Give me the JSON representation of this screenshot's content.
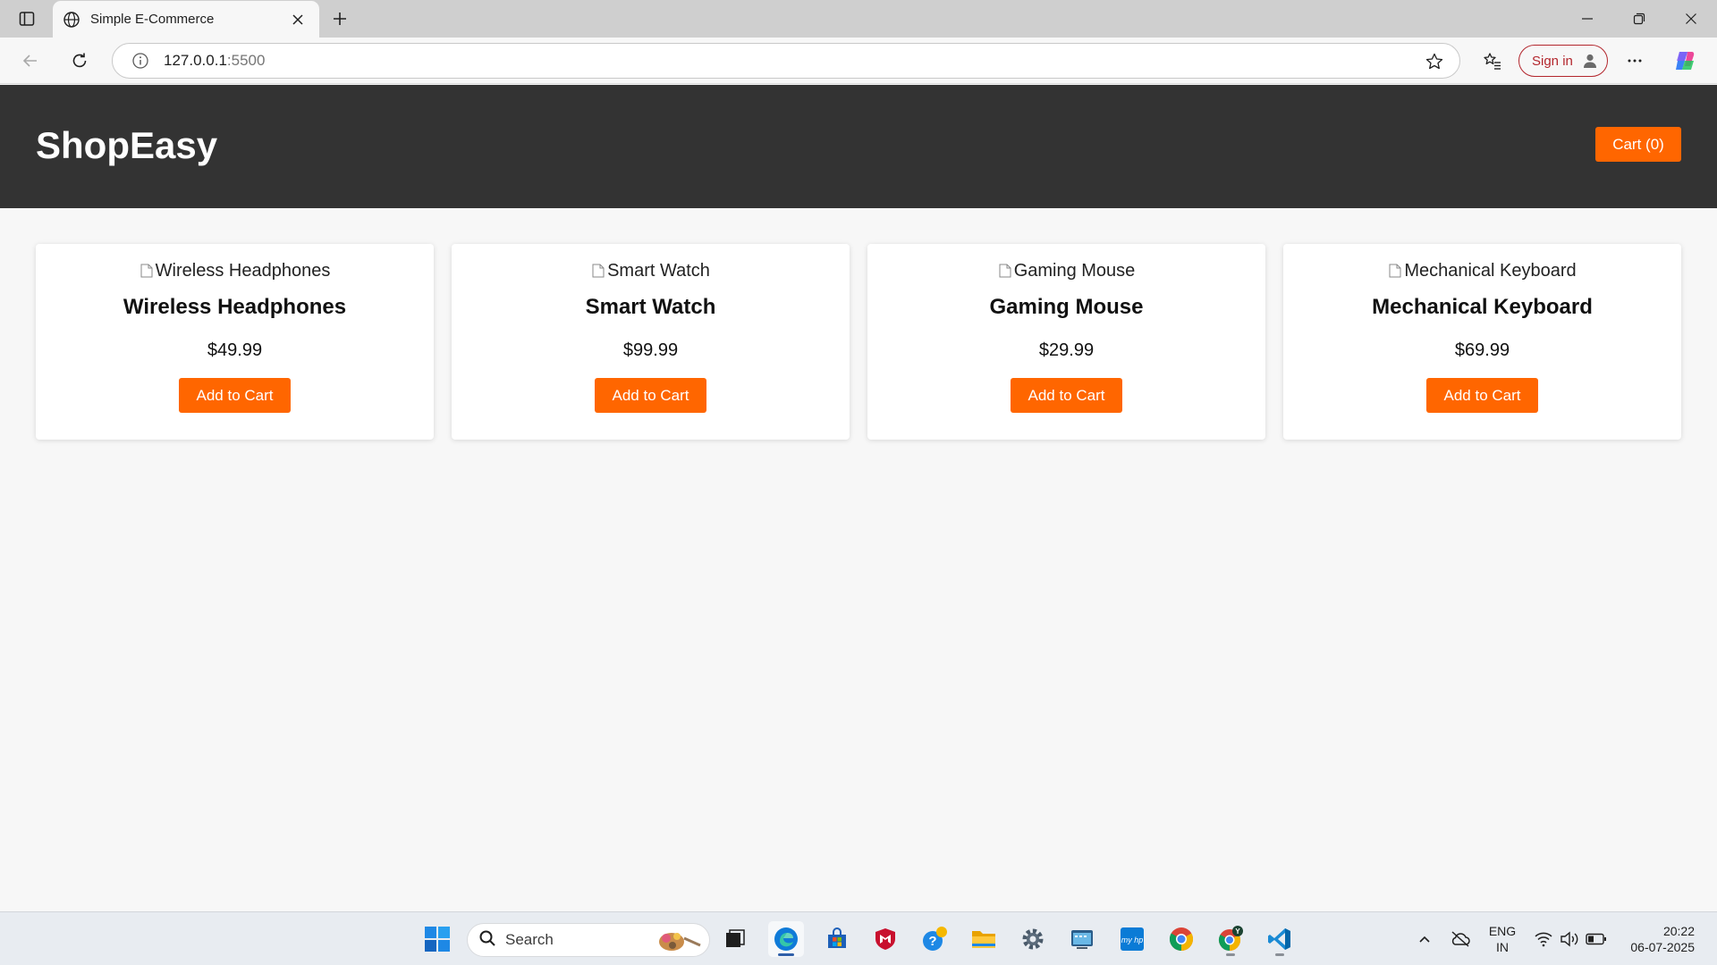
{
  "browser": {
    "tab_title": "Simple E-Commerce",
    "url_host": "127.0.0.1",
    "url_port": ":5500",
    "signin_label": "Sign in"
  },
  "site": {
    "brand": "ShopEasy",
    "cart_label": "Cart (0)"
  },
  "products": [
    {
      "alt": "Wireless Headphones",
      "name": "Wireless Headphones",
      "price": "$49.99",
      "button": "Add to Cart"
    },
    {
      "alt": "Smart Watch",
      "name": "Smart Watch",
      "price": "$99.99",
      "button": "Add to Cart"
    },
    {
      "alt": "Gaming Mouse",
      "name": "Gaming Mouse",
      "price": "$29.99",
      "button": "Add to Cart"
    },
    {
      "alt": "Mechanical Keyboard",
      "name": "Mechanical Keyboard",
      "price": "$69.99",
      "button": "Add to Cart"
    }
  ],
  "taskbar": {
    "search_label": "Search",
    "lang_line1": "ENG",
    "lang_line2": "IN",
    "time": "20:22",
    "date": "06-07-2025"
  },
  "colors": {
    "accent": "#ff6600",
    "header_bg": "#333333",
    "page_bg": "#f7f7f7"
  },
  "icons": {
    "tab_actions": "tab-actions-icon",
    "tab_favicon": "globe-icon",
    "back": "back-arrow-icon",
    "refresh": "refresh-icon",
    "site_info": "info-icon",
    "favorite": "star-icon",
    "favorites_list": "favorites-icon",
    "more": "more-icon",
    "copilot": "copilot-icon",
    "start": "windows-start-icon"
  }
}
